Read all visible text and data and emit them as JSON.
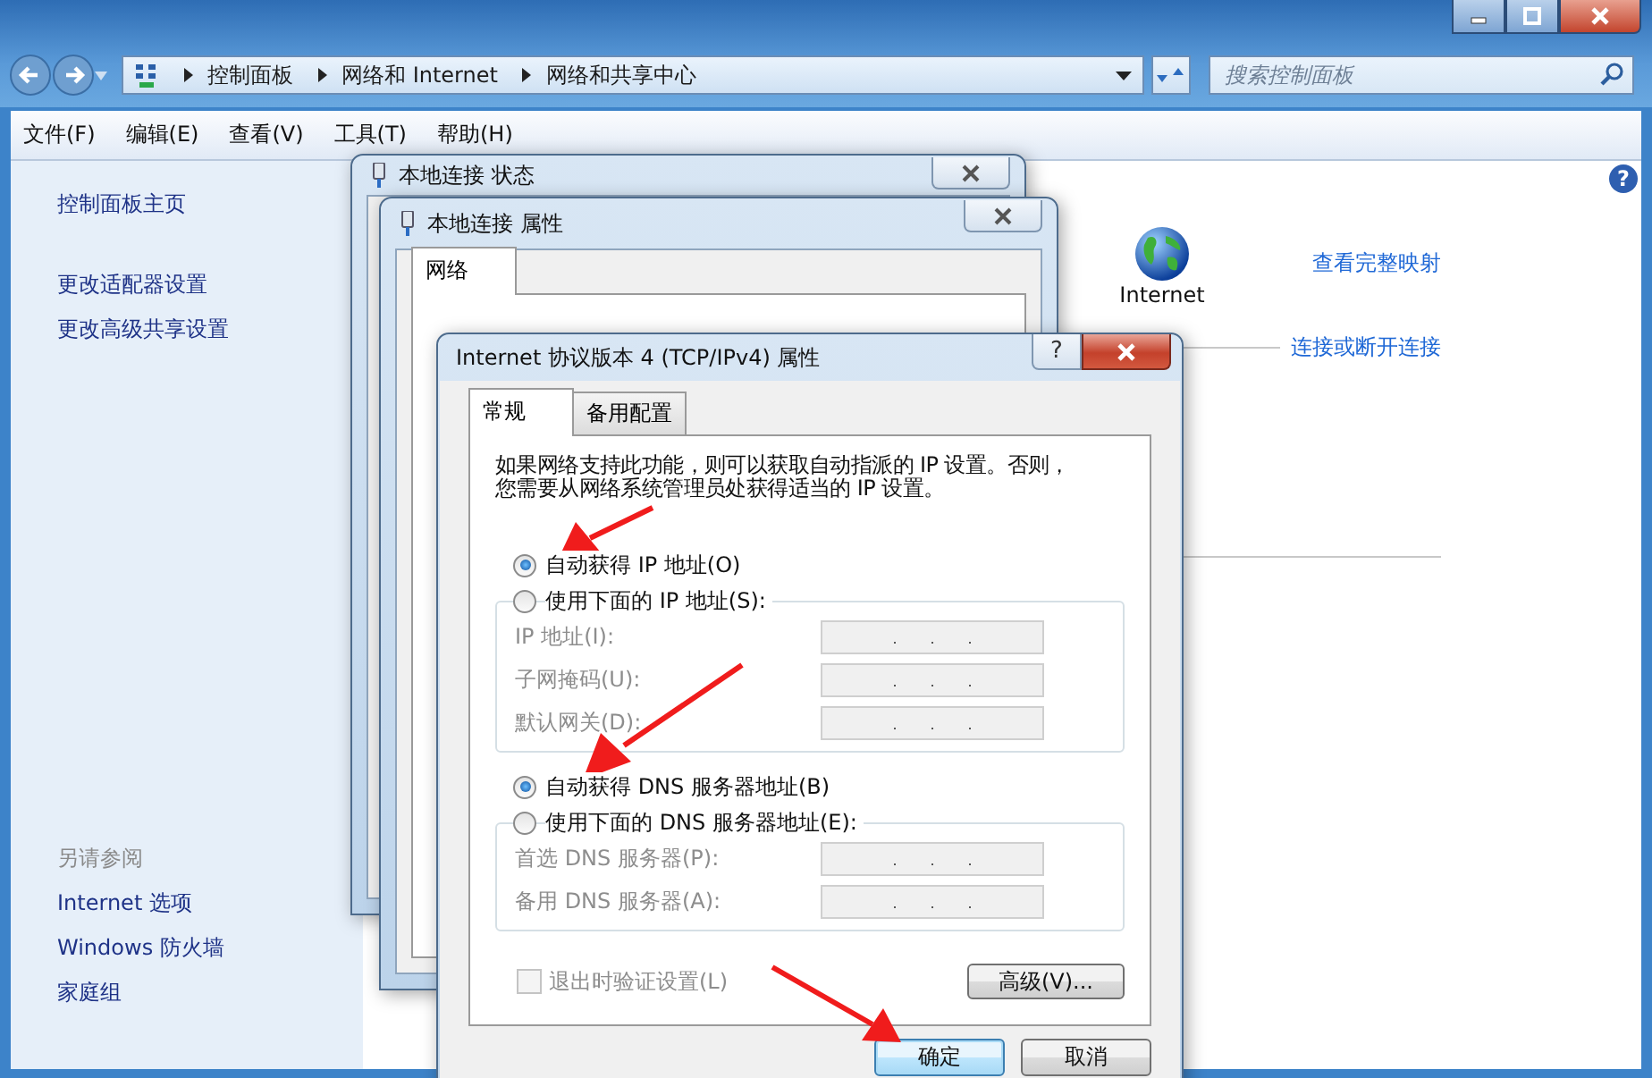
{
  "explorer": {
    "address_path": [
      "控制面板",
      "网络和 Internet",
      "网络和共享中心"
    ],
    "search": {
      "placeholder": "搜索控制面板"
    },
    "menu": [
      "文件(F)",
      "编辑(E)",
      "查看(V)",
      "工具(T)",
      "帮助(H)"
    ],
    "sidebar": {
      "items": [
        "控制面板主页",
        "更改适配器设置",
        "更改高级共享设置"
      ],
      "see_also_title": "另请参阅",
      "see_also": [
        "Internet 选项",
        "Windows 防火墙",
        "家庭组"
      ]
    },
    "content": {
      "help_button": "?",
      "network_label": "Internet",
      "links": [
        "查看完整映射",
        "连接或断开连接"
      ]
    }
  },
  "windows": [
    {
      "title": "本地连接 状态"
    },
    {
      "title": "本地连接 属性",
      "tabs": [
        {
          "label": "网络",
          "selected": true
        }
      ]
    }
  ],
  "dialog": {
    "title": "Internet 协议版本 4 (TCP/IPv4) 属性",
    "tabs": [
      {
        "label": "常规",
        "selected": true
      },
      {
        "label": "备用配置",
        "selected": false
      }
    ],
    "help_button": "?",
    "description_lines": [
      "如果网络支持此功能，则可以获取自动指派的 IP 设置。否则，",
      "您需要从网络系统管理员处获得适当的 IP 设置。"
    ],
    "ip_options": [
      {
        "label": "自动获得 IP 地址(O)",
        "selected": true
      },
      {
        "label": "使用下面的 IP 地址(S):",
        "selected": false
      }
    ],
    "ip_fields": [
      {
        "label": "IP 地址(I):",
        "disabled": true
      },
      {
        "label": "子网掩码(U):",
        "disabled": true
      },
      {
        "label": "默认网关(D):",
        "disabled": true
      }
    ],
    "dns_options": [
      {
        "label": "自动获得 DNS 服务器地址(B)",
        "selected": true
      },
      {
        "label": "使用下面的 DNS 服务器地址(E):",
        "selected": false
      }
    ],
    "dns_fields": [
      {
        "label": "首选 DNS 服务器(P):",
        "disabled": true
      },
      {
        "label": "备用 DNS 服务器(A):",
        "disabled": true
      }
    ],
    "validate": {
      "label": "退出时验证设置(L)",
      "checked": false,
      "disabled": true
    },
    "advanced_button": "高级(V)...",
    "buttons": [
      {
        "label": "确定",
        "default": true
      },
      {
        "label": "取消",
        "default": false
      }
    ]
  }
}
